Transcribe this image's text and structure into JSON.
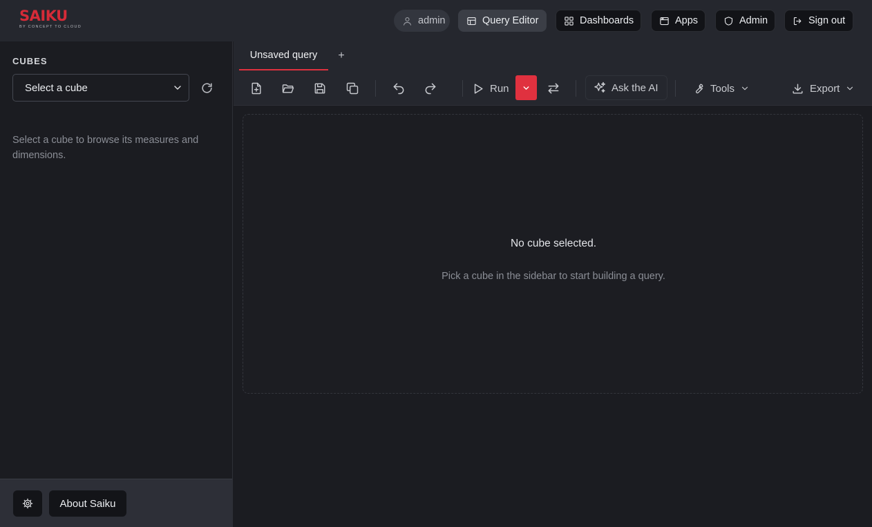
{
  "brand": {
    "name": "SAIKU",
    "tagline": "BY CONCEPT TO CLOUD",
    "accent_color": "#d62b38"
  },
  "header": {
    "user": {
      "label": "admin",
      "icon": "user-icon"
    },
    "nav": [
      {
        "label": "Query Editor",
        "icon": "table-icon",
        "active": true
      },
      {
        "label": "Dashboards",
        "icon": "grid-icon",
        "active": false
      },
      {
        "label": "Apps",
        "icon": "window-icon",
        "active": false
      },
      {
        "label": "Admin",
        "icon": "shield-icon",
        "active": false
      },
      {
        "label": "Sign out",
        "icon": "sign-out-icon",
        "active": false
      }
    ]
  },
  "sidebar": {
    "section_title": "CUBES",
    "cube_select": {
      "value": "Select a cube",
      "icon": "chevron-down-icon"
    },
    "refresh_icon": "refresh-icon",
    "hint": "Select a cube to browse its measures and dimensions.",
    "footer": {
      "settings_icon": "gear-icon",
      "about_label": "About Saiku"
    }
  },
  "tabs": {
    "items": [
      {
        "label": "Unsaved query",
        "active": true
      }
    ],
    "add_label": "+"
  },
  "toolbar": {
    "file_icons": [
      "new-query-icon",
      "open-folder-icon",
      "save-icon",
      "duplicate-icon"
    ],
    "history_icons": [
      "undo-icon",
      "redo-icon"
    ],
    "run_label": "Run",
    "run_menu_icon": "chevron-down-icon",
    "swap_icon": "swap-axes-icon",
    "ai_label": "Ask the AI",
    "tools_label": "Tools",
    "export_label": "Export",
    "run_accent": "#e0313f"
  },
  "main": {
    "empty_title": "No cube selected.",
    "empty_subtitle": "Pick a cube in the sidebar to start building a query."
  }
}
